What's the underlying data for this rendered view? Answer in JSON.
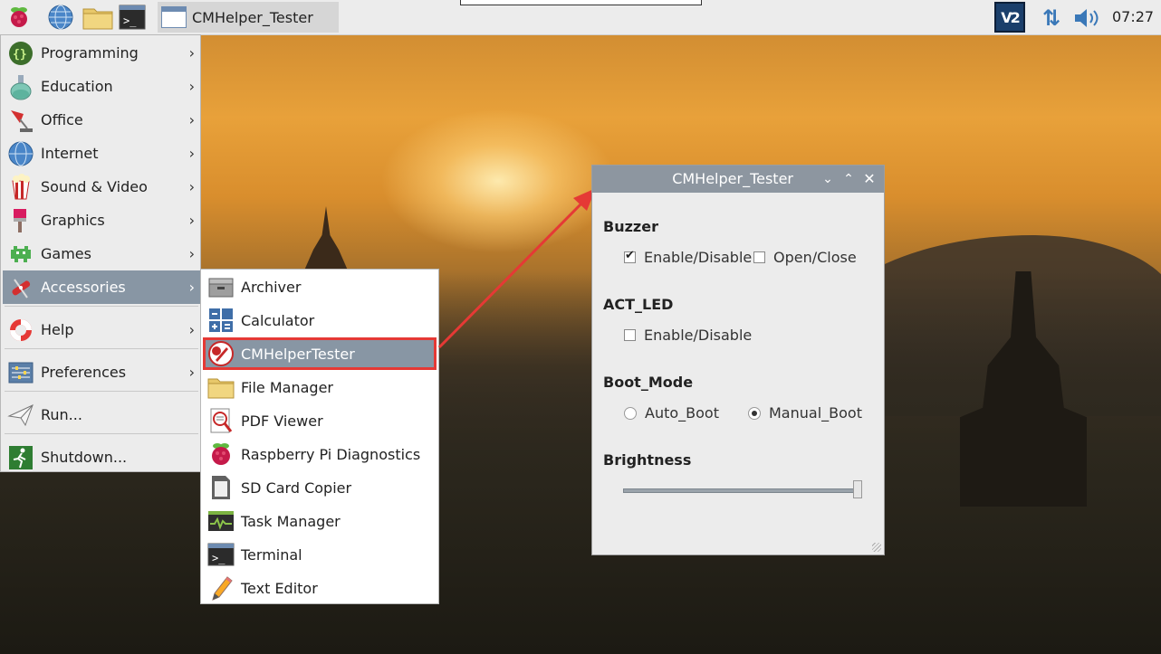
{
  "taskbar": {
    "window_title": "CMHelper_Tester",
    "clock": "07:27",
    "vnc_label": "V2"
  },
  "main_menu": {
    "items": [
      {
        "label": "Programming",
        "icon": "programming-icon"
      },
      {
        "label": "Education",
        "icon": "education-flask-icon"
      },
      {
        "label": "Office",
        "icon": "office-lamp-icon"
      },
      {
        "label": "Internet",
        "icon": "globe-icon"
      },
      {
        "label": "Sound & Video",
        "icon": "popcorn-icon"
      },
      {
        "label": "Graphics",
        "icon": "paintbrush-icon"
      },
      {
        "label": "Games",
        "icon": "space-invader-icon"
      },
      {
        "label": "Accessories",
        "icon": "swiss-knife-icon"
      },
      {
        "label": "Help",
        "icon": "lifebuoy-icon"
      },
      {
        "label": "Preferences",
        "icon": "sliders-icon"
      },
      {
        "label": "Run...",
        "icon": "paper-plane-icon"
      },
      {
        "label": "Shutdown...",
        "icon": "exit-man-icon"
      }
    ],
    "arrow": "›"
  },
  "sub_menu": {
    "items": [
      {
        "label": "Archiver"
      },
      {
        "label": "Calculator"
      },
      {
        "label": "CMHelperTester"
      },
      {
        "label": "File Manager"
      },
      {
        "label": "PDF Viewer"
      },
      {
        "label": "Raspberry Pi Diagnostics"
      },
      {
        "label": "SD Card Copier"
      },
      {
        "label": "Task Manager"
      },
      {
        "label": "Terminal"
      },
      {
        "label": "Text Editor"
      }
    ]
  },
  "dialog": {
    "title": "CMHelper_Tester",
    "buzzer": {
      "heading": "Buzzer",
      "enable_label": "Enable/Disable",
      "open_label": "Open/Close"
    },
    "act_led": {
      "heading": "ACT_LED",
      "enable_label": "Enable/Disable"
    },
    "boot_mode": {
      "heading": "Boot_Mode",
      "auto_label": "Auto_Boot",
      "manual_label": "Manual_Boot"
    },
    "brightness": {
      "heading": "Brightness",
      "level": 1.0
    }
  },
  "colors": {
    "menu_highlight": "#8896a4",
    "dialog_title_bar": "#8d96a0",
    "annotation_red": "#e53935"
  }
}
